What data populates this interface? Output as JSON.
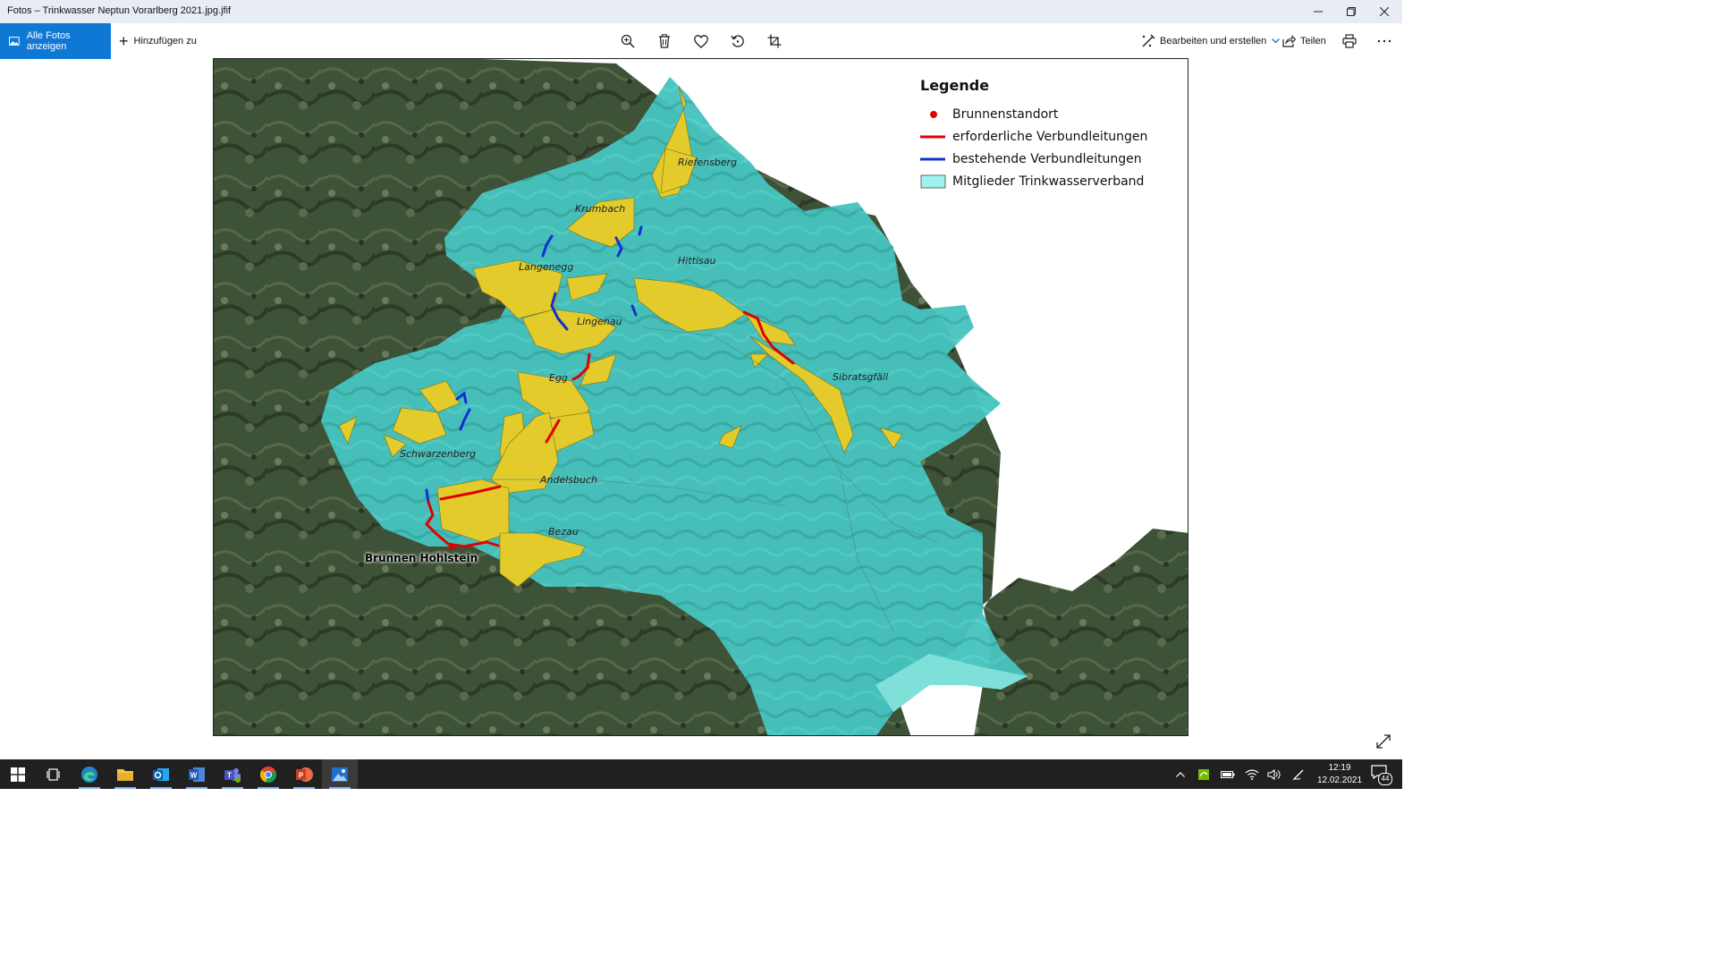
{
  "window": {
    "title": "Fotos – Trinkwasser Neptun Vorarlberg 2021.jpg.jfif",
    "controls": [
      "minimize",
      "maximize",
      "close"
    ]
  },
  "toolbar": {
    "all_photos_label": "Alle Fotos anzeigen",
    "add_to_label": "Hinzufügen zu",
    "edit_label": "Bearbeiten und erstellen",
    "share_label": "Teilen",
    "icons": [
      "zoom-icon",
      "delete-icon",
      "favorite-icon",
      "rotate-icon",
      "crop-icon",
      "print-icon",
      "more-icon"
    ]
  },
  "map": {
    "legend": {
      "title": "Legende",
      "items": [
        {
          "label": "Brunnenstandort",
          "color": "#e10000"
        },
        {
          "label": "erforderliche Verbundleitungen",
          "color": "#e10000"
        },
        {
          "label": "bestehende Verbundleitungen",
          "color": "#1030d0"
        },
        {
          "label": "Mitglieder Trinkwasserverband",
          "color": "#9ff3ee"
        }
      ]
    },
    "places": {
      "riefensberg": "Riefensberg",
      "krumbach": "Krumbach",
      "hittisau": "Hittisau",
      "langenegg": "Langenegg",
      "lingenau": "Lingenau",
      "egg": "Egg",
      "sibratsgfaell": "Sibratsgfäll",
      "schwarzenberg": "Schwarzenberg",
      "andelsbuch": "Andelsbuch",
      "bezau": "Bezau"
    },
    "well_label": "Brunnen Hohlstein",
    "colors": {
      "member_area": "#48c5c0",
      "settlement": "#e3cb2c",
      "terrain": "#3e5238"
    }
  },
  "taskbar": {
    "apps": [
      "start-icon",
      "task-view-icon",
      "edge-icon",
      "file-explorer-icon",
      "outlook-icon",
      "word-icon",
      "teams-icon",
      "chrome-icon",
      "powerpoint-icon",
      "photos-icon"
    ],
    "time": "12:19",
    "date": "12.02.2021",
    "notification_count": "44"
  }
}
